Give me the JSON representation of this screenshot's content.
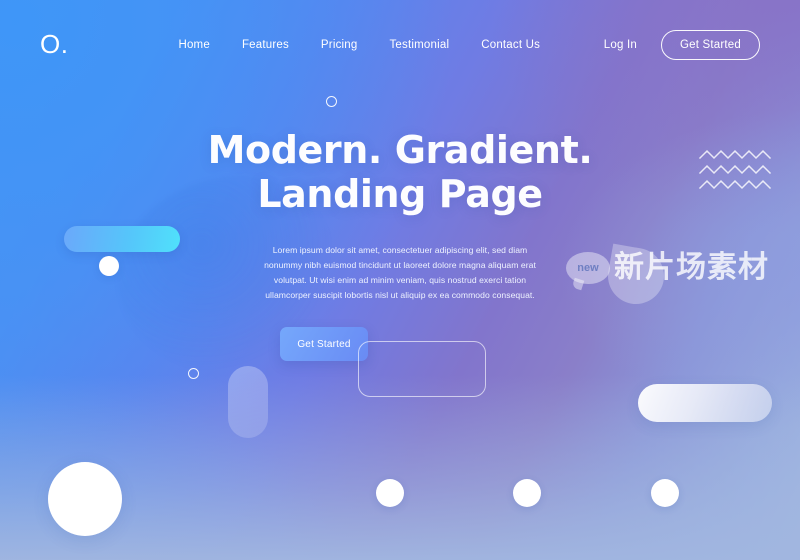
{
  "navbar": {
    "logo": "O.",
    "links": [
      {
        "label": "Home"
      },
      {
        "label": "Features"
      },
      {
        "label": "Pricing"
      },
      {
        "label": "Testimonial"
      },
      {
        "label": "Contact Us"
      }
    ],
    "login_label": "Log In",
    "cta_label": "Get Started"
  },
  "hero": {
    "headline_line1": "Modern. Gradient.",
    "headline_line2": "Landing Page",
    "paragraph": "Lorem ipsum dolor sit amet, consectetuer adipiscing elit, sed diam nonummy nibh euismod tincidunt ut laoreet dolore magna aliquam erat volutpat. Ut wisi enim ad minim veniam, quis nostrud exerci tation ullamcorper suscipit lobortis nisl ut aliquip ex ea commodo consequat.",
    "cta_label": "Get Started"
  },
  "watermark": {
    "badge_label": "new",
    "text": "新片场素材"
  },
  "colors": {
    "gradient_top_left": "#4a93f2",
    "gradient_top_right": "#8872c8",
    "gradient_mid_right": "#8e9cde",
    "gradient_bottom": "#a1b6e0",
    "accent_cyan": "#50e4fc",
    "cta_blue": "#76aafc",
    "text_white": "#ffffff"
  }
}
